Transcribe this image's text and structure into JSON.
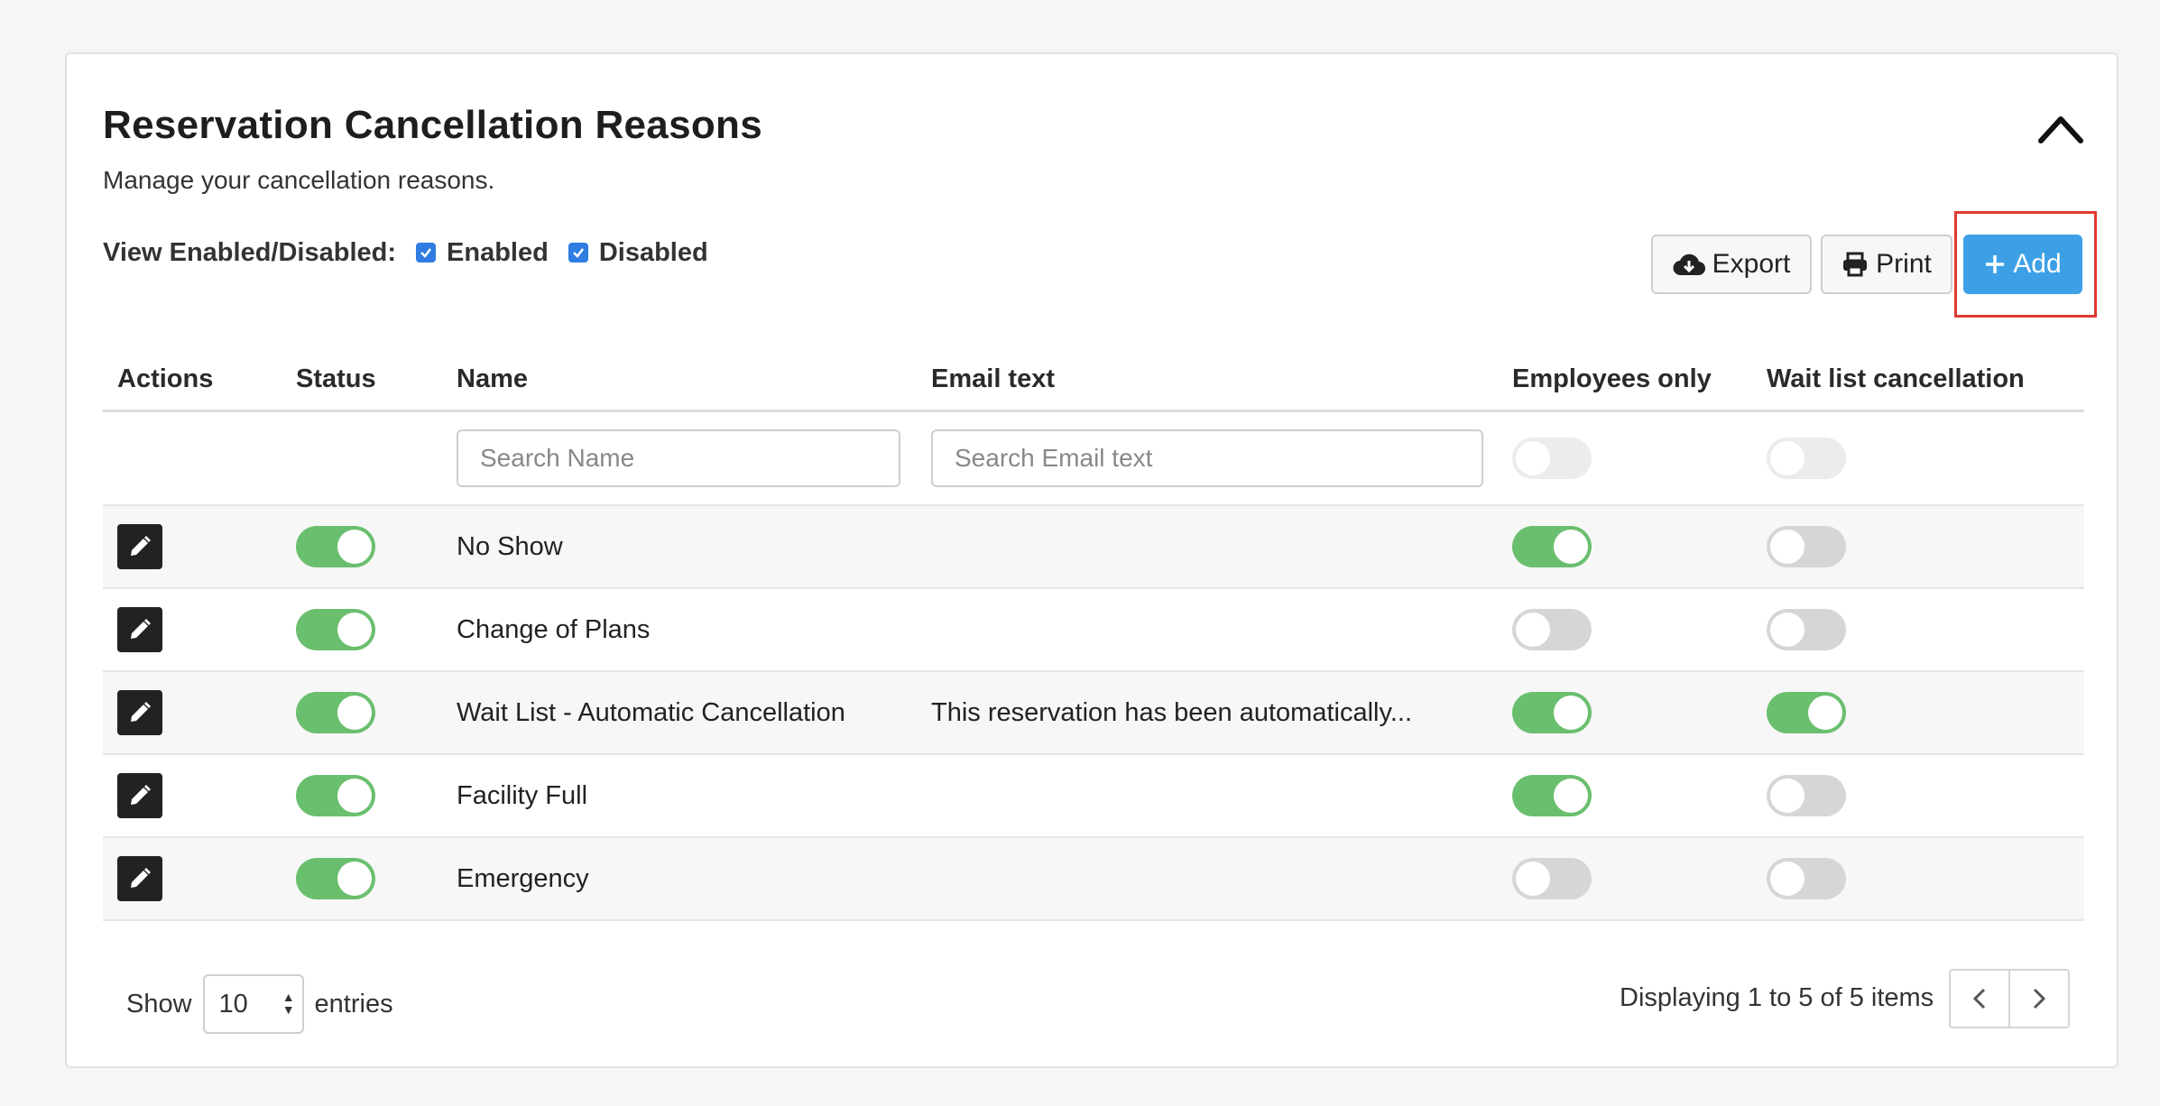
{
  "header": {
    "title": "Reservation Cancellation Reasons",
    "subtitle": "Manage your cancellation reasons."
  },
  "filter": {
    "label": "View Enabled/Disabled:",
    "enabled_label": "Enabled",
    "disabled_label": "Disabled",
    "enabled_checked": true,
    "disabled_checked": true
  },
  "toolbar": {
    "export_label": "Export",
    "print_label": "Print",
    "add_label": "Add"
  },
  "table": {
    "headers": [
      "Actions",
      "Status",
      "Name",
      "Email text",
      "Employees only",
      "Wait list cancellation"
    ],
    "search": {
      "name_placeholder": "Search Name",
      "email_placeholder": "Search Email text"
    },
    "rows": [
      {
        "status": true,
        "name": "No Show",
        "email_text": "",
        "employees_only": true,
        "wait_list": false
      },
      {
        "status": true,
        "name": "Change of Plans",
        "email_text": "",
        "employees_only": false,
        "wait_list": false
      },
      {
        "status": true,
        "name": "Wait List - Automatic Cancellation",
        "email_text": "This reservation has been automatically...",
        "employees_only": true,
        "wait_list": true
      },
      {
        "status": true,
        "name": "Facility Full",
        "email_text": "",
        "employees_only": true,
        "wait_list": false
      },
      {
        "status": true,
        "name": "Emergency",
        "email_text": "",
        "employees_only": false,
        "wait_list": false
      }
    ]
  },
  "footer": {
    "show_label": "Show",
    "page_size": "10",
    "entries_label": "entries",
    "info": "Displaying 1 to 5 of 5 items"
  },
  "colors": {
    "accent": "#3da0e6",
    "toggle_on": "#6abf6e",
    "toggle_off": "#d6d6d6",
    "highlight": "#e03a2e"
  }
}
